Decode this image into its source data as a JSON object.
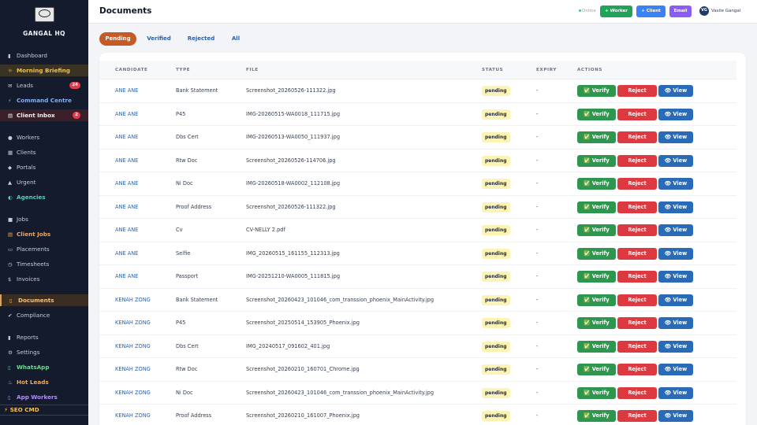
{
  "app": {
    "brand": "GANGAL HQ",
    "logo_text": "GANGAL"
  },
  "sidebar": {
    "items": [
      {
        "label": "Dashboard",
        "icon": "chart-icon",
        "glyph": "▮"
      },
      {
        "label": "Morning Briefing",
        "icon": "sunrise-icon",
        "glyph": "☼"
      },
      {
        "label": "Leads",
        "icon": "envelope-icon",
        "glyph": "✉",
        "badge": "24"
      },
      {
        "label": "Command Centre",
        "icon": "lightning-icon",
        "glyph": "⚡"
      },
      {
        "label": "Client Inbox",
        "icon": "inbox-icon",
        "glyph": "▤",
        "badge": "2"
      },
      {
        "label": "Workers",
        "icon": "people-icon",
        "glyph": "●"
      },
      {
        "label": "Clients",
        "icon": "building-icon",
        "glyph": "▦"
      },
      {
        "label": "Portals",
        "icon": "lock-icon",
        "glyph": "◆"
      },
      {
        "label": "Urgent",
        "icon": "siren-icon",
        "glyph": "▲"
      },
      {
        "label": "Agencies",
        "icon": "handshake-icon",
        "glyph": "◐"
      },
      {
        "label": "Jobs",
        "icon": "briefcase-icon",
        "glyph": "■"
      },
      {
        "label": "Client Jobs",
        "icon": "inbox-icon",
        "glyph": "▤"
      },
      {
        "label": "Placements",
        "icon": "clipboard-icon",
        "glyph": "▭"
      },
      {
        "label": "Timesheets",
        "icon": "clock-icon",
        "glyph": "◷"
      },
      {
        "label": "Invoices",
        "icon": "money-icon",
        "glyph": "$"
      },
      {
        "label": "Documents",
        "icon": "document-icon",
        "glyph": "▯"
      },
      {
        "label": "Compliance",
        "icon": "check-icon",
        "glyph": "✔"
      },
      {
        "label": "Reports",
        "icon": "chart-icon",
        "glyph": "▮"
      },
      {
        "label": "Settings",
        "icon": "gear-icon",
        "glyph": "⚙"
      },
      {
        "label": "WhatsApp",
        "icon": "phone-icon",
        "glyph": "▯"
      },
      {
        "label": "Hot Leads",
        "icon": "fire-icon",
        "glyph": "♨"
      },
      {
        "label": "App Workers",
        "icon": "phone-icon",
        "glyph": "▯"
      }
    ],
    "bottom": {
      "label": "SEO CMD",
      "icon": "lightning-icon",
      "glyph": "⚡"
    }
  },
  "header": {
    "title": "Documents",
    "online": "Online",
    "worker_btn": "+ Worker",
    "client_btn": "+ Client",
    "email_btn": "Email",
    "user_initials": "VG",
    "user_name": "Vasile Gangal"
  },
  "tabs": [
    {
      "label": "Pending",
      "active": true
    },
    {
      "label": "Verified"
    },
    {
      "label": "Rejected"
    },
    {
      "label": "All"
    }
  ],
  "table": {
    "columns": [
      "CANDIDATE",
      "TYPE",
      "FILE",
      "STATUS",
      "EXPIRY",
      "ACTIONS"
    ],
    "action_labels": {
      "verify": "✅ Verify",
      "reject": "Reject",
      "view": "👁 View"
    },
    "rows": [
      {
        "candidate": "ANE ANE",
        "type": "Bank Statement",
        "file": "Screenshot_20260526-111322.jpg",
        "status": "pending",
        "expiry": "-"
      },
      {
        "candidate": "ANE ANE",
        "type": "P45",
        "file": "IMG-20260515-WA0018_111715.jpg",
        "status": "pending",
        "expiry": "-"
      },
      {
        "candidate": "ANE ANE",
        "type": "Dbs Cert",
        "file": "IMG-20260513-WA0050_111937.jpg",
        "status": "pending",
        "expiry": "-"
      },
      {
        "candidate": "ANE ANE",
        "type": "Rtw Doc",
        "file": "Screenshot_20260526-114706.jpg",
        "status": "pending",
        "expiry": "-"
      },
      {
        "candidate": "ANE ANE",
        "type": "Ni Doc",
        "file": "IMG-20260518-WA0002_112108.jpg",
        "status": "pending",
        "expiry": "-"
      },
      {
        "candidate": "ANE ANE",
        "type": "Proof Address",
        "file": "Screenshot_20260526-111322.jpg",
        "status": "pending",
        "expiry": "-"
      },
      {
        "candidate": "ANE ANE",
        "type": "Cv",
        "file": "CV-NELLY 2.pdf",
        "status": "pending",
        "expiry": "-"
      },
      {
        "candidate": "ANE ANE",
        "type": "Selfie",
        "file": "IMG_20260515_161155_112313.jpg",
        "status": "pending",
        "expiry": "-"
      },
      {
        "candidate": "ANE ANE",
        "type": "Passport",
        "file": "IMG-20251210-WA0005_111815.jpg",
        "status": "pending",
        "expiry": "-"
      },
      {
        "candidate": "KENAH ZONG",
        "type": "Bank Statement",
        "file": "Screenshot_20260423_101046_com_transsion_phoenix_MainActivity.jpg",
        "status": "pending",
        "expiry": "-"
      },
      {
        "candidate": "KENAH ZONG",
        "type": "P45",
        "file": "Screenshot_20250514_153905_Phoenix.jpg",
        "status": "pending",
        "expiry": "-"
      },
      {
        "candidate": "KENAH ZONG",
        "type": "Dbs Cert",
        "file": "IMG_20240517_091602_401.jpg",
        "status": "pending",
        "expiry": "-"
      },
      {
        "candidate": "KENAH ZONG",
        "type": "Rtw Doc",
        "file": "Screenshot_20260210_160701_Chrome.jpg",
        "status": "pending",
        "expiry": "-"
      },
      {
        "candidate": "KENAH ZONG",
        "type": "Ni Doc",
        "file": "Screenshot_20260423_101046_com_transsion_phoenix_MainActivity.jpg",
        "status": "pending",
        "expiry": "-"
      },
      {
        "candidate": "KENAH ZONG",
        "type": "Proof Address",
        "file": "Screenshot_20260210_161007_Phoenix.jpg",
        "status": "pending",
        "expiry": "-"
      }
    ]
  }
}
